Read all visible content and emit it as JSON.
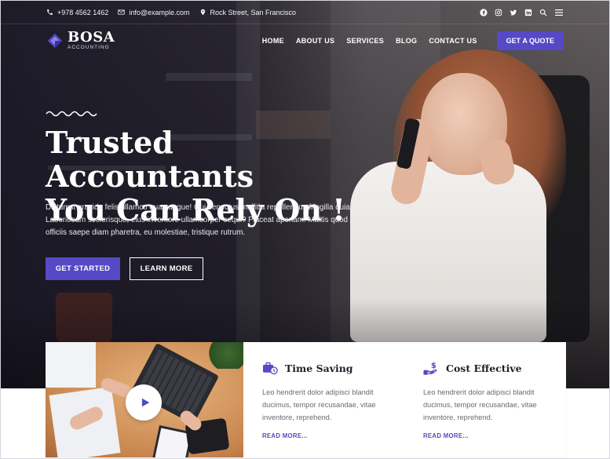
{
  "topbar": {
    "phone": "+978 4562 1462",
    "email": "info@example.com",
    "address": "Rock Street, San Francisco",
    "social_icons": [
      "facebook-icon",
      "instagram-icon",
      "twitter-icon",
      "linkedin-icon"
    ],
    "utility_icons": [
      "search-icon",
      "menu-icon"
    ]
  },
  "nav": {
    "logo_name": "BOSA",
    "logo_sub": "ACCOUNTING",
    "items": [
      "HOME",
      "ABOUT US",
      "SERVICES",
      "BLOG",
      "CONTACT US"
    ],
    "quote_label": "GET A QUOTE"
  },
  "hero": {
    "headline_line1": "Trusted Accountants",
    "headline_line2": "You Can Rely On !",
    "lead": "Dictumst gravida felis ullamco quas augue! Qui senectus mollitia repellendus fringilla quia! Laboriosam scelerisque, eius inventore ullamcorper sequi? Placeat aperiam. Mattis quod officiis saepe diam pharetra, eu molestiae, tristique rutrum.",
    "primary_cta": "GET STARTED",
    "secondary_cta": "LEARN MORE"
  },
  "features": [
    {
      "icon": "briefcase-clock-icon",
      "title": "Time Saving",
      "text": "Leo hendrerit dolor adipisci blandit ducimus, tempor recusandae, vitae inventore, reprehend.",
      "link": "READ MORE..."
    },
    {
      "icon": "hand-dollar-icon",
      "title": "Cost Effective",
      "text": "Leo hendrerit dolor adipisci blandit ducimus, tempor recusandae, vitae inventore, reprehend.",
      "link": "READ MORE..."
    }
  ],
  "colors": {
    "accent": "#5549c6",
    "hero_overlay": "#161422",
    "text_muted": "#6a6a75"
  }
}
